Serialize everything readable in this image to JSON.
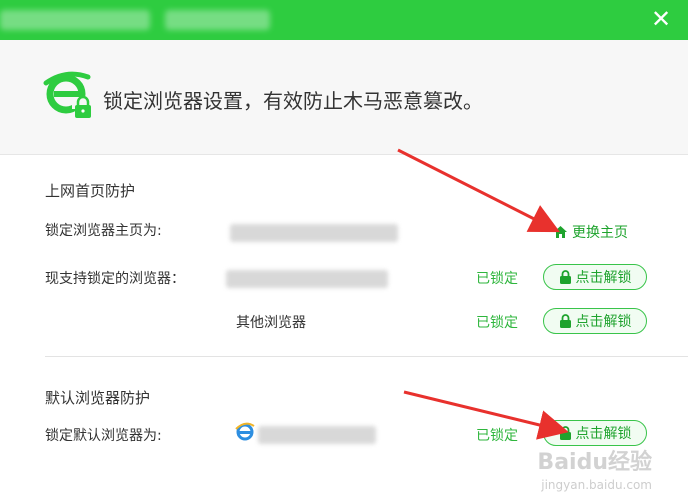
{
  "window": {
    "close_glyph": "✕"
  },
  "banner": {
    "text": "锁定浏览器设置，有效防止木马恶意篡改。"
  },
  "homepage_section": {
    "title": "上网首页防护",
    "homepage_label": "锁定浏览器主页为:",
    "change_home_label": "更换主页",
    "supported_label": "现支持锁定的浏览器：",
    "other_browsers_label": "其他浏览器",
    "rows": [
      {
        "status": "已锁定",
        "button": "点击解锁"
      },
      {
        "status": "已锁定",
        "button": "点击解锁"
      }
    ]
  },
  "default_section": {
    "title": "默认浏览器防护",
    "default_label": "锁定默认浏览器为:",
    "status": "已锁定",
    "button": "点击解锁"
  },
  "watermark": {
    "brand": "Baidu经验",
    "url": "jingyan.baidu.com"
  },
  "colors": {
    "accent": "#2ecc40",
    "status_green": "#2fb63d",
    "arrow_red": "#e8312d"
  }
}
